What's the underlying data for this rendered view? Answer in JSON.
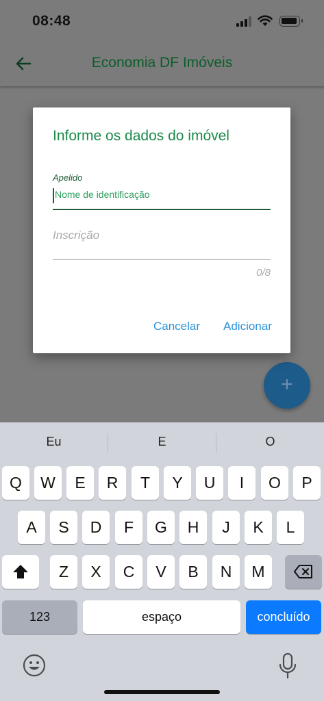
{
  "status_bar": {
    "time": "08:48"
  },
  "app_bar": {
    "title": "Economia DF Imóveis"
  },
  "dialog": {
    "title": "Informe os dados do imóvel",
    "field1": {
      "label": "Apelido",
      "placeholder": "Nome de identificação"
    },
    "field2": {
      "label": "Inscrição",
      "counter": "0/8"
    },
    "cancel_label": "Cancelar",
    "add_label": "Adicionar"
  },
  "fab": {
    "icon": "plus-icon",
    "symbol": "+"
  },
  "keyboard": {
    "suggestions": [
      "Eu",
      "E",
      "O"
    ],
    "row1": [
      "Q",
      "W",
      "E",
      "R",
      "T",
      "Y",
      "U",
      "I",
      "O",
      "P"
    ],
    "row2": [
      "A",
      "S",
      "D",
      "F",
      "G",
      "H",
      "J",
      "K",
      "L"
    ],
    "row3": [
      "Z",
      "X",
      "C",
      "V",
      "B",
      "N",
      "M"
    ],
    "numbers_label": "123",
    "space_label": "espaço",
    "done_label": "concluído"
  },
  "colors": {
    "title_green": "#0b5d2a",
    "accent_green": "#1b8a4a",
    "button_blue": "#2a92d8",
    "keyboard_blue": "#0b7aff"
  }
}
